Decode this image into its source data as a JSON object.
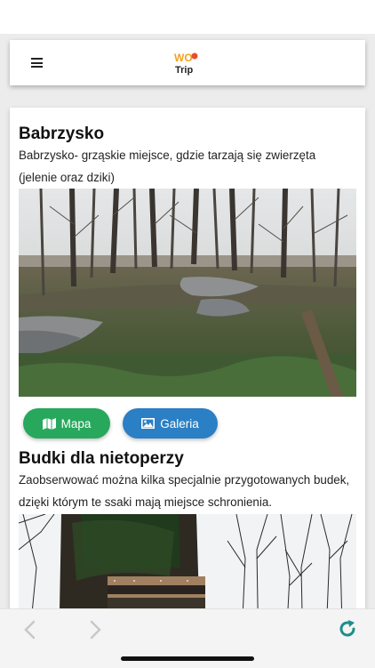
{
  "header": {
    "menu_icon": "hamburger-menu-icon",
    "logo_text_top": "WO",
    "logo_text_bottom": "Trip"
  },
  "places": [
    {
      "title": "Babrzysko",
      "description": "Babrzysko- grząskie miejsce, gdzie tarzają się zwierzęta (jelenie oraz dziki)",
      "photo": "swampy-forest-clearing-photo",
      "buttons": {
        "map_label": "Mapa",
        "map_icon": "map-icon",
        "gallery_label": "Galeria",
        "gallery_icon": "image-icon",
        "map_color": "#27a85c",
        "gallery_color": "#2b7fc4"
      }
    },
    {
      "title": "Budki dla nietoperzy",
      "description": "Zaobserwować można kilka specjalnie przygotowanych budek, dzięki którym te ssaki mają miejsce schronienia.",
      "photo": "bat-boxes-on-tree-photo"
    }
  ],
  "bottom_bar": {
    "back_icon": "back-arrow-icon",
    "forward_icon": "forward-arrow-icon",
    "refresh_icon": "refresh-icon",
    "refresh_color": "#1e8e8a"
  }
}
